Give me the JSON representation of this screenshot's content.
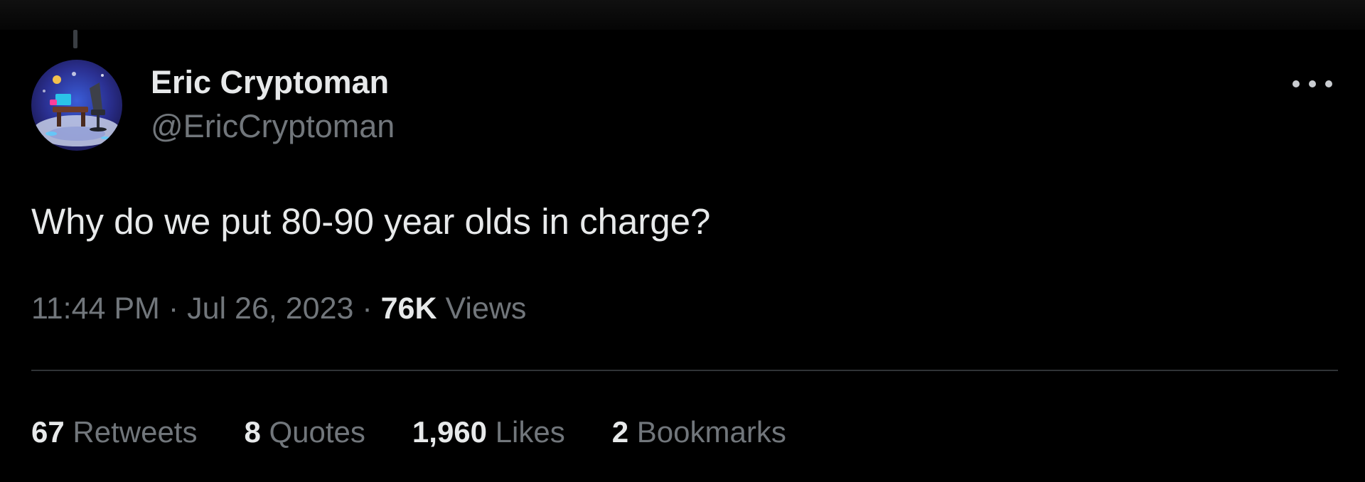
{
  "author": {
    "display_name": "Eric Cryptoman",
    "handle": "@EricCryptoman"
  },
  "tweet": {
    "text": "Why do we put 80-90 year olds in charge?",
    "time": "11:44 PM",
    "separator": "·",
    "date": "Jul 26, 2023",
    "views_count": "76K",
    "views_label": "Views"
  },
  "stats": [
    {
      "count": "67",
      "label": "Retweets"
    },
    {
      "count": "8",
      "label": "Quotes"
    },
    {
      "count": "1,960",
      "label": "Likes"
    },
    {
      "count": "2",
      "label": "Bookmarks"
    }
  ],
  "icons": {
    "more": "more-horizontal-icon",
    "avatar": "avatar-image"
  },
  "colors": {
    "background": "#000000",
    "primary_text": "#e7e9ea",
    "secondary_text": "#71767b",
    "divider": "#2f3336"
  }
}
